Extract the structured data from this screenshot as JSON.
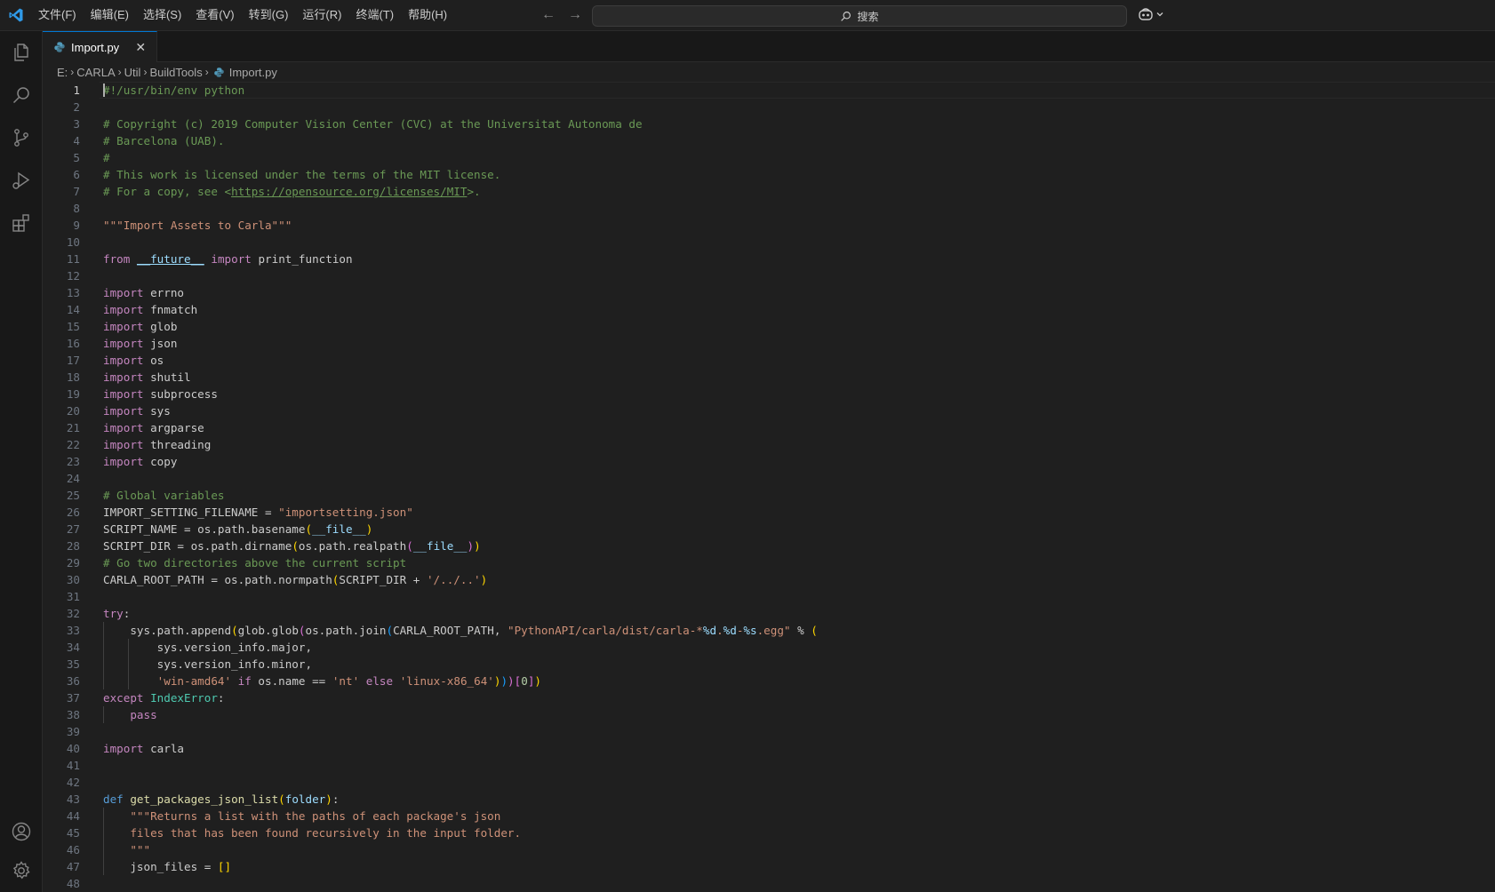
{
  "app": {
    "menu": [
      "文件(F)",
      "编辑(E)",
      "选择(S)",
      "查看(V)",
      "转到(G)",
      "运行(R)",
      "终端(T)",
      "帮助(H)"
    ],
    "search_placeholder": "搜索",
    "accent": "#0078d4"
  },
  "activity_bar": {
    "top": [
      "files-icon",
      "search-icon",
      "source-control-icon",
      "run-debug-icon",
      "extensions-icon"
    ],
    "bottom": [
      "account-icon",
      "settings-gear-icon"
    ]
  },
  "tab": {
    "label": "Import.py",
    "icon": "python-file-icon"
  },
  "breadcrumb": [
    "E:",
    "CARLA",
    "Util",
    "BuildTools",
    "Import.py"
  ],
  "editor": {
    "active_line": 1,
    "lines": [
      {
        "n": "1",
        "t": [
          {
            "c": "com",
            "v": "#!/usr/bin/env python"
          }
        ]
      },
      {
        "n": "2",
        "t": []
      },
      {
        "n": "3",
        "t": [
          {
            "c": "com",
            "v": "# Copyright (c) 2019 Computer Vision Center (CVC) at the Universitat Autonoma de"
          }
        ]
      },
      {
        "n": "4",
        "t": [
          {
            "c": "com",
            "v": "# Barcelona (UAB)."
          }
        ]
      },
      {
        "n": "5",
        "t": [
          {
            "c": "com",
            "v": "#"
          }
        ]
      },
      {
        "n": "6",
        "t": [
          {
            "c": "com",
            "v": "# This work is licensed under the terms of the MIT license."
          }
        ]
      },
      {
        "n": "7",
        "t": [
          {
            "c": "com",
            "v": "# For a copy, see <"
          },
          {
            "c": "com link",
            "v": "https://opensource.org/licenses/MIT"
          },
          {
            "c": "com",
            "v": ">."
          }
        ]
      },
      {
        "n": "8",
        "t": []
      },
      {
        "n": "9",
        "t": [
          {
            "c": "str",
            "v": "\"\"\"Import Assets to Carla\"\"\""
          }
        ]
      },
      {
        "n": "10",
        "t": []
      },
      {
        "n": "11",
        "t": [
          {
            "c": "ctl",
            "v": "from"
          },
          {
            "c": "",
            "v": " "
          },
          {
            "c": "var link",
            "v": "__future__"
          },
          {
            "c": "",
            "v": " "
          },
          {
            "c": "ctl",
            "v": "import"
          },
          {
            "c": "",
            "v": " print_function"
          }
        ]
      },
      {
        "n": "12",
        "t": []
      },
      {
        "n": "13",
        "t": [
          {
            "c": "ctl",
            "v": "import"
          },
          {
            "c": "",
            "v": " errno"
          }
        ]
      },
      {
        "n": "14",
        "t": [
          {
            "c": "ctl",
            "v": "import"
          },
          {
            "c": "",
            "v": " fnmatch"
          }
        ]
      },
      {
        "n": "15",
        "t": [
          {
            "c": "ctl",
            "v": "import"
          },
          {
            "c": "",
            "v": " glob"
          }
        ]
      },
      {
        "n": "16",
        "t": [
          {
            "c": "ctl",
            "v": "import"
          },
          {
            "c": "",
            "v": " json"
          }
        ]
      },
      {
        "n": "17",
        "t": [
          {
            "c": "ctl",
            "v": "import"
          },
          {
            "c": "",
            "v": " os"
          }
        ]
      },
      {
        "n": "18",
        "t": [
          {
            "c": "ctl",
            "v": "import"
          },
          {
            "c": "",
            "v": " shutil"
          }
        ]
      },
      {
        "n": "19",
        "t": [
          {
            "c": "ctl",
            "v": "import"
          },
          {
            "c": "",
            "v": " subprocess"
          }
        ]
      },
      {
        "n": "20",
        "t": [
          {
            "c": "ctl",
            "v": "import"
          },
          {
            "c": "",
            "v": " sys"
          }
        ]
      },
      {
        "n": "21",
        "t": [
          {
            "c": "ctl",
            "v": "import"
          },
          {
            "c": "",
            "v": " argparse"
          }
        ]
      },
      {
        "n": "22",
        "t": [
          {
            "c": "ctl",
            "v": "import"
          },
          {
            "c": "",
            "v": " threading"
          }
        ]
      },
      {
        "n": "23",
        "t": [
          {
            "c": "ctl",
            "v": "import"
          },
          {
            "c": "",
            "v": " copy"
          }
        ]
      },
      {
        "n": "24",
        "t": []
      },
      {
        "n": "25",
        "t": [
          {
            "c": "com",
            "v": "# Global variables"
          }
        ]
      },
      {
        "n": "26",
        "t": [
          {
            "c": "",
            "v": "IMPORT_SETTING_FILENAME = "
          },
          {
            "c": "str",
            "v": "\"importsetting.json\""
          }
        ]
      },
      {
        "n": "27",
        "t": [
          {
            "c": "",
            "v": "SCRIPT_NAME = os.path.basename"
          },
          {
            "c": "b1",
            "v": "("
          },
          {
            "c": "var",
            "v": "__file__"
          },
          {
            "c": "b1",
            "v": ")"
          }
        ]
      },
      {
        "n": "28",
        "t": [
          {
            "c": "",
            "v": "SCRIPT_DIR = os.path.dirname"
          },
          {
            "c": "b1",
            "v": "("
          },
          {
            "c": "",
            "v": "os.path.realpath"
          },
          {
            "c": "b2",
            "v": "("
          },
          {
            "c": "var",
            "v": "__file__"
          },
          {
            "c": "b2",
            "v": ")"
          },
          {
            "c": "b1",
            "v": ")"
          }
        ]
      },
      {
        "n": "29",
        "t": [
          {
            "c": "com",
            "v": "# Go two directories above the current script"
          }
        ]
      },
      {
        "n": "30",
        "t": [
          {
            "c": "",
            "v": "CARLA_ROOT_PATH = os.path.normpath"
          },
          {
            "c": "b1",
            "v": "("
          },
          {
            "c": "",
            "v": "SCRIPT_DIR + "
          },
          {
            "c": "str",
            "v": "'/../..'"
          },
          {
            "c": "b1",
            "v": ")"
          }
        ]
      },
      {
        "n": "31",
        "t": []
      },
      {
        "n": "32",
        "t": [
          {
            "c": "ctl",
            "v": "try"
          },
          {
            "c": "",
            "v": ":"
          }
        ]
      },
      {
        "n": "33",
        "t": [
          {
            "c": "",
            "v": "    sys.path.append"
          },
          {
            "c": "b1",
            "v": "("
          },
          {
            "c": "",
            "v": "glob.glob"
          },
          {
            "c": "b2",
            "v": "("
          },
          {
            "c": "",
            "v": "os.path.join"
          },
          {
            "c": "b3",
            "v": "("
          },
          {
            "c": "",
            "v": "CARLA_ROOT_PATH, "
          },
          {
            "c": "str",
            "v": "\"PythonAPI/carla/dist/carla-*"
          },
          {
            "c": "var",
            "v": "%d"
          },
          {
            "c": "str",
            "v": "."
          },
          {
            "c": "var",
            "v": "%d"
          },
          {
            "c": "str",
            "v": "-"
          },
          {
            "c": "var",
            "v": "%s"
          },
          {
            "c": "str",
            "v": ".egg\""
          },
          {
            "c": "",
            "v": " % "
          },
          {
            "c": "b1",
            "v": "("
          }
        ]
      },
      {
        "n": "34",
        "t": [
          {
            "c": "",
            "v": "        sys.version_info.major,"
          }
        ]
      },
      {
        "n": "35",
        "t": [
          {
            "c": "",
            "v": "        sys.version_info.minor,"
          }
        ]
      },
      {
        "n": "36",
        "t": [
          {
            "c": "str",
            "v": "        'win-amd64'"
          },
          {
            "c": "",
            "v": " "
          },
          {
            "c": "ctl",
            "v": "if"
          },
          {
            "c": "",
            "v": " os.name == "
          },
          {
            "c": "str",
            "v": "'nt'"
          },
          {
            "c": "",
            "v": " "
          },
          {
            "c": "ctl",
            "v": "else"
          },
          {
            "c": "",
            "v": " "
          },
          {
            "c": "str",
            "v": "'linux-x86_64'"
          },
          {
            "c": "b1",
            "v": ")"
          },
          {
            "c": "b3",
            "v": ")"
          },
          {
            "c": "b2",
            "v": ")"
          },
          {
            "c": "b2",
            "v": "["
          },
          {
            "c": "num",
            "v": "0"
          },
          {
            "c": "b2",
            "v": "]"
          },
          {
            "c": "b1",
            "v": ")"
          }
        ]
      },
      {
        "n": "37",
        "t": [
          {
            "c": "ctl",
            "v": "except"
          },
          {
            "c": "",
            "v": " "
          },
          {
            "c": "cls",
            "v": "IndexError"
          },
          {
            "c": "",
            "v": ":"
          }
        ]
      },
      {
        "n": "38",
        "t": [
          {
            "c": "",
            "v": "    "
          },
          {
            "c": "ctl",
            "v": "pass"
          }
        ]
      },
      {
        "n": "39",
        "t": []
      },
      {
        "n": "40",
        "t": [
          {
            "c": "ctl",
            "v": "import"
          },
          {
            "c": "",
            "v": " carla"
          }
        ]
      },
      {
        "n": "41",
        "t": []
      },
      {
        "n": "42",
        "t": []
      },
      {
        "n": "43",
        "t": [
          {
            "c": "kw",
            "v": "def"
          },
          {
            "c": "",
            "v": " "
          },
          {
            "c": "fn",
            "v": "get_packages_json_list"
          },
          {
            "c": "b1",
            "v": "("
          },
          {
            "c": "var",
            "v": "folder"
          },
          {
            "c": "b1",
            "v": ")"
          },
          {
            "c": "",
            "v": ":"
          }
        ]
      },
      {
        "n": "44",
        "t": [
          {
            "c": "str",
            "v": "    \"\"\"Returns a list with the paths of each package's json"
          }
        ]
      },
      {
        "n": "45",
        "t": [
          {
            "c": "str",
            "v": "    files that has been found recursively in the input folder."
          }
        ]
      },
      {
        "n": "46",
        "t": [
          {
            "c": "str",
            "v": "    \"\"\""
          }
        ]
      },
      {
        "n": "47",
        "t": [
          {
            "c": "",
            "v": "    json_files = "
          },
          {
            "c": "b1",
            "v": "[]"
          }
        ]
      },
      {
        "n": "48",
        "t": []
      }
    ]
  }
}
